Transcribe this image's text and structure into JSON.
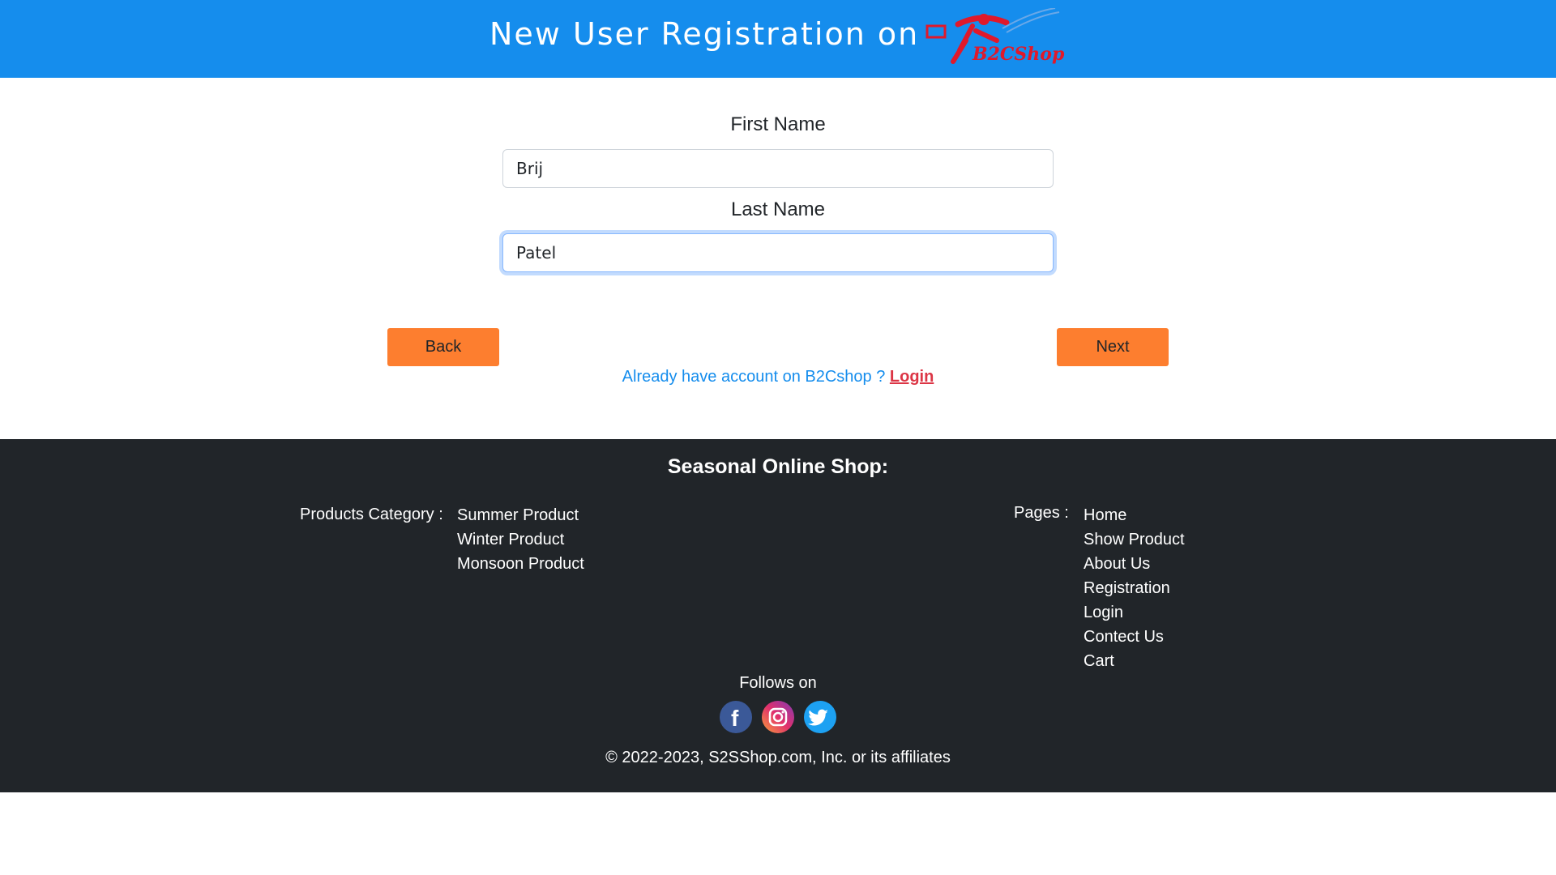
{
  "header": {
    "title": "New User Registration on",
    "logo_text": "B2CShop"
  },
  "form": {
    "first_name": {
      "label": "First Name",
      "value": "Brij"
    },
    "last_name": {
      "label": "Last Name",
      "value": "Patel"
    }
  },
  "buttons": {
    "back": "Back",
    "next": "Next"
  },
  "login_prompt": {
    "text": "Already have account on B2Cshop ? ",
    "link": "Login"
  },
  "footer": {
    "title": "Seasonal Online Shop:",
    "categories_label": "Products Category :",
    "categories": [
      "Summer Product",
      "Winter Product",
      "Monsoon Product"
    ],
    "pages_label": "Pages :",
    "pages": [
      "Home",
      "Show Product",
      "About Us",
      "Registration",
      "Login",
      "Contect Us",
      "Cart"
    ],
    "follows": "Follows on",
    "socials": [
      "facebook-icon",
      "instagram-icon",
      "twitter-icon"
    ],
    "copyright": "© 2022-2023, S2SShop.com, Inc. or its affiliates"
  },
  "colors": {
    "header": "#158ded",
    "button": "#fd7e2f",
    "footer": "#212529",
    "link": "#dc3545"
  }
}
